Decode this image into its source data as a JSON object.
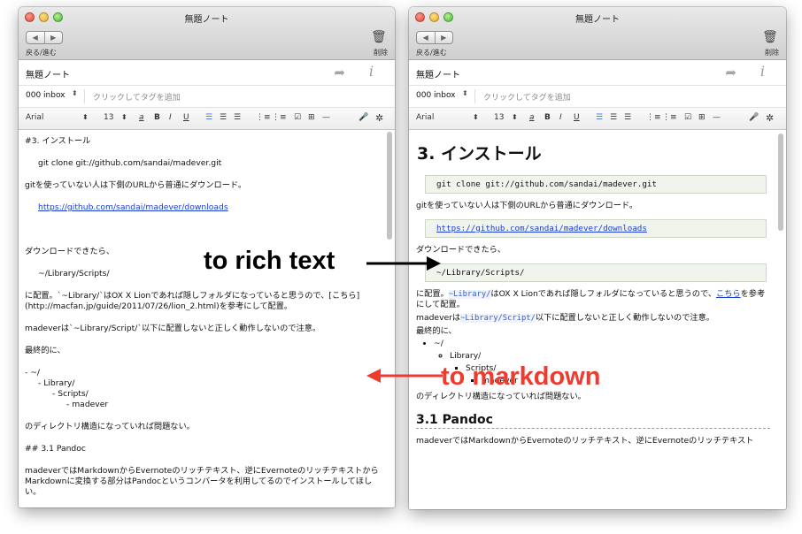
{
  "left": {
    "title": "無題ノート",
    "nav_back": "◀",
    "nav_forward": "▶",
    "nav_label": "戻る/進む",
    "trash_label": "削除",
    "note_title": "無題ノート",
    "notebook": "000 inbox",
    "notebook_arrow": "⬍",
    "tag_placeholder": "クリックしてタグを追加",
    "font": "Arial",
    "font_arrow": "⬍",
    "size": "13",
    "size_arrow": "⬍",
    "lines": {
      "h3": "#3. インストール",
      "clone": "git clone git://github.com/sandai/madever.git",
      "no_git": "gitを使っていない人は下側のURLから普通にダウンロード。",
      "dl_url": "https://github.com/sandai/madever/downloads",
      "after_dl": "ダウンロードできたら、",
      "scripts": "~/Library/Scripts/",
      "place1": "に配置。`~Library/`はOX X Lionであれば隠しフォルダになっていると思うので、[こちら](http://macfan.jp/guide/2011/07/26/lion_2.html)を参考にして配置。",
      "madever_note": "madeverは`~Library/Script/`以下に配置しないと正しく動作しないので注意。",
      "finally": "最終的に、",
      "tree1": "- ~/",
      "tree2": "- Library/",
      "tree3": "- Scripts/",
      "tree4": "- madever",
      "struct_ok": "のディレクトリ構造になっていれば問題ない。",
      "h31": "## 3.1 Pandoc",
      "pandoc": "madeverではMarkdownからEvernoteのリッチテキスト、逆にEvernoteのリッチテキストからMarkdownに変換する部分はPandocというコンバータを利用してるのでインストールしてほしい。"
    }
  },
  "right": {
    "title": "無題ノート",
    "nav_back": "◀",
    "nav_forward": "▶",
    "nav_label": "戻る/進む",
    "trash_label": "削除",
    "note_title": "無題ノート",
    "notebook": "000 inbox",
    "notebook_arrow": "⬍",
    "tag_placeholder": "クリックしてタグを追加",
    "font": "Arial",
    "font_arrow": "⬍",
    "size": "13",
    "size_arrow": "⬍",
    "content": {
      "h1": "3. インストール",
      "clone": "git clone git://github.com/sandai/madever.git",
      "no_git": "gitを使っていない人は下側のURLから普通にダウンロード。",
      "dl_url": "https://github.com/sandai/madever/downloads",
      "after_dl": "ダウンロードできたら、",
      "scripts": "~/Library/Scripts/",
      "place_a": "に配置。",
      "place_code": "~Library/",
      "place_b": "はOX X Lionであれば隠しフォルダになっていると思うので、",
      "place_link": "こちら",
      "place_c": "を参考にして配置。",
      "madever_a": "madeverは",
      "madever_code": "~Library/Script/",
      "madever_b": "以下に配置しないと正しく動作しないので注意。",
      "finally": "最終的に、",
      "tree1": "~/",
      "tree2": "Library/",
      "tree3": "Scripts/",
      "tree4": "madever",
      "struct_ok": "のディレクトリ構造になっていれば問題ない。",
      "h2": "3.1 Pandoc",
      "pandoc": "madeverではMarkdownからEvernoteのリッチテキスト、逆にEvernoteのリッチテキスト"
    }
  },
  "annotations": {
    "to_rich": "to rich text",
    "to_markdown": "to markdown",
    "to_rich_color": "#000000",
    "to_markdown_color": "#ee3b2f"
  },
  "icons": {
    "trash": "🗑",
    "share": "➦",
    "info": "i",
    "mic": "🎤",
    "settings": "✲",
    "bold": "B",
    "italic": "I",
    "underline": "U",
    "text_color": "a",
    "checkbox": "☑",
    "table": "⊞",
    "hr": "—"
  }
}
